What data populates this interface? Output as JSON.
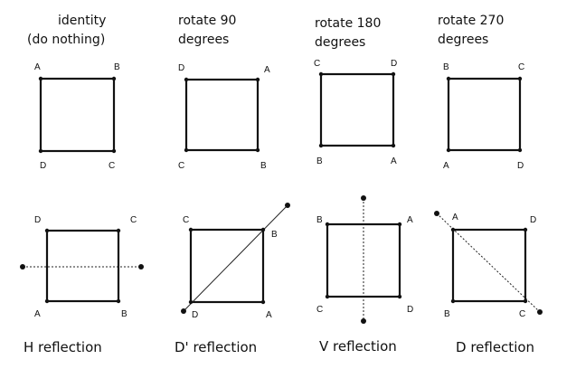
{
  "panels": [
    {
      "title_lines": [
        "identity",
        "(do nothing)"
      ],
      "corners": {
        "tl": "A",
        "tr": "B",
        "bl": "D",
        "br": "C"
      }
    },
    {
      "title_lines": [
        "rotate 90",
        "degrees"
      ],
      "corners": {
        "tl": "D",
        "tr": "A",
        "bl": "C",
        "br": "B"
      }
    },
    {
      "title_lines": [
        "rotate 180",
        "degrees"
      ],
      "corners": {
        "tl": "C",
        "tr": "D",
        "bl": "B",
        "br": "A"
      }
    },
    {
      "title_lines": [
        "rotate 270",
        "degrees"
      ],
      "corners": {
        "tl": "B",
        "tr": "C",
        "bl": "A",
        "br": "D"
      }
    },
    {
      "caption": "H reflection",
      "axis": "horizontal",
      "corners": {
        "tl": "D",
        "tr": "C",
        "bl": "A",
        "br": "B"
      }
    },
    {
      "caption": "D' reflection",
      "axis": "anti-diagonal",
      "corners": {
        "tl": "C",
        "tr": "B",
        "bl": "D",
        "br": "A"
      }
    },
    {
      "caption": "V reflection",
      "axis": "vertical",
      "corners": {
        "tl": "B",
        "tr": "A",
        "bl": "C",
        "br": "D"
      }
    },
    {
      "caption": "D reflection",
      "axis": "diagonal",
      "corners": {
        "tl": "A",
        "tr": "D",
        "bl": "B",
        "br": "C"
      }
    }
  ]
}
